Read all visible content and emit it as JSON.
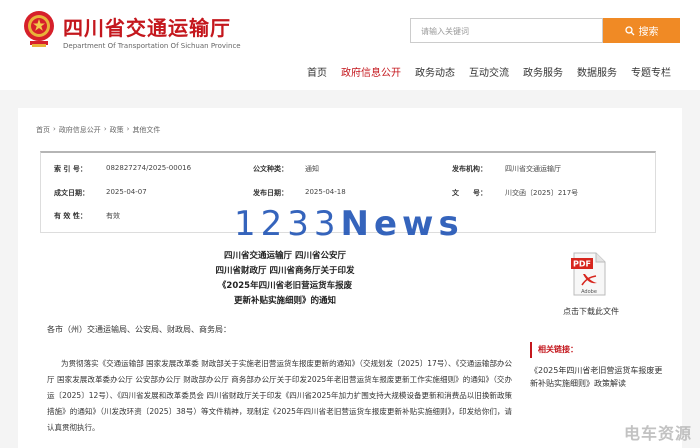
{
  "header": {
    "title": "四川省交通运输厅",
    "subtitle": "Department Of Transportation Of Sichuan Province",
    "emblem_icon": "national-emblem-icon",
    "brand_color": "#c4171d"
  },
  "search": {
    "placeholder": "请输入关键词",
    "button_label": "搜索",
    "button_icon": "search-icon",
    "button_color": "#f08a25"
  },
  "nav": {
    "items": [
      {
        "label": "首页",
        "active": false
      },
      {
        "label": "政府信息公开",
        "active": true
      },
      {
        "label": "政务动态",
        "active": false
      },
      {
        "label": "互动交流",
        "active": false
      },
      {
        "label": "政务服务",
        "active": false
      },
      {
        "label": "数据服务",
        "active": false
      },
      {
        "label": "专题专栏",
        "active": false
      }
    ]
  },
  "breadcrumb": [
    "首页",
    "›",
    "政府信息公开",
    "›",
    "政策",
    "›",
    "其他文件"
  ],
  "meta": {
    "index_label": "索 引 号：",
    "index_value": "082827274/2025-00016",
    "category_label": "公文种类：",
    "category_value": "通知",
    "issuer_label": "发布机构：",
    "issuer_value": "四川省交通运输厅",
    "created_label": "成文日期：",
    "created_value": "2025-04-07",
    "published_label": "发布日期：",
    "published_value": "2025-04-18",
    "docno_label": "文　　号：",
    "docno_value": "川交函〔2025〕217号",
    "validity_label": "有 效 性：",
    "validity_value": "有效"
  },
  "watermark": {
    "digits": "1233",
    "word": "News"
  },
  "article": {
    "title_lines": [
      "四川省交通运输厅 四川省公安厅",
      "四川省财政厅 四川省商务厅关于印发",
      "《2025年四川省老旧营运货车报废",
      "更新补贴实施细则》的通知"
    ],
    "recipients": "各市（州）交通运输局、公安局、财政局、商务局：",
    "body": "为贯彻落实《交通运输部 国家发展改革委 财政部关于实施老旧营运货车报废更新的通知》（交规划发〔2025〕17号）、《交通运输部办公厅 国家发展改革委办公厅 公安部办公厅 财政部办公厅 商务部办公厅关于印发2025年老旧营运货车报废更新工作实施细则》的通知》（交办运〔2025〕12号）、《四川省发展和改革委员会 四川省财政厅关于印发《四川省2025年加力扩围支持大规模设备更新和消费品以旧换新政策措施》的通知》（川发改环资〔2025〕38号）等文件精神，现制定《2025年四川省老旧营运货车报废更新补贴实施细则》，印发给你们，请认真贯彻执行。"
  },
  "download": {
    "icon": "pdf-file-icon",
    "icon_text": "PDF",
    "icon_brand": "Adobe",
    "label": "点击下载此文件"
  },
  "related": {
    "header": "相关链接：",
    "link": "《2025年四川省老旧营运货车报废更新补贴实施细则》政策解读"
  },
  "corner_mark": "电车资源"
}
